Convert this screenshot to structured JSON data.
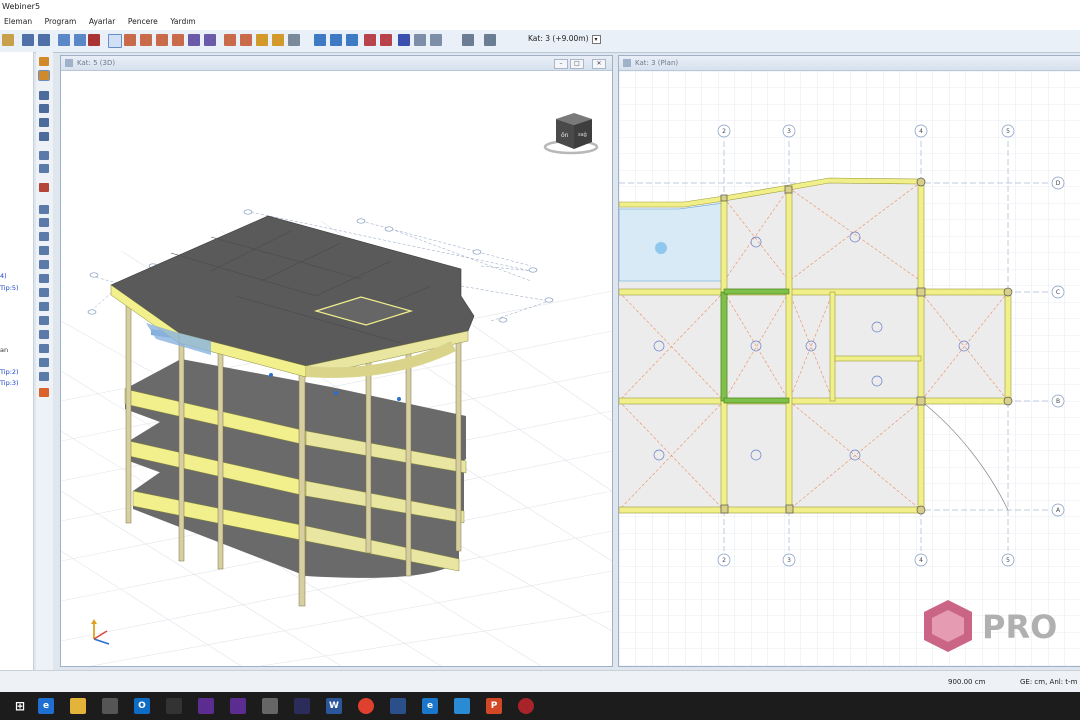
{
  "app": {
    "title": "Webiner5"
  },
  "menu": [
    "Eleman",
    "Program",
    "Ayarlar",
    "Pencere",
    "Yardım"
  ],
  "toolbar": {
    "floor_label": "Kat: 3 (+9.00m)"
  },
  "left_panel": {
    "labels": [
      "4)",
      "Tip:5)",
      "an",
      "Tip:2)",
      "Tip:3)"
    ]
  },
  "pane_3d": {
    "title": "Kat: 5 (3D)",
    "view_cube": {
      "face_front": "ön",
      "face_right": "sağ"
    }
  },
  "pane_plan": {
    "title": "Kat: 3 (Plan)",
    "grid_x": [
      "2",
      "3",
      "4",
      "5"
    ],
    "grid_y": [
      "D",
      "C",
      "B",
      "A"
    ]
  },
  "status": {
    "scale": "900.00 cm",
    "units": "GE: cm, Anl: t-m"
  },
  "watermark": {
    "text": "PRO"
  },
  "taskbar": {
    "icons": [
      "start",
      "edge",
      "explorer",
      "store",
      "outlook",
      "app",
      "visual-studio",
      "visual-studio",
      "calculator",
      "app",
      "word",
      "chrome",
      "app",
      "ie",
      "app",
      "powerpoint",
      "app"
    ]
  },
  "colors": {
    "slab": "#5a5a5a",
    "beam": "#f2f08c",
    "column": "#d8cfa0",
    "plan_beam": "#f0ef8a",
    "plan_grid": "#c9d4e4",
    "accent": "#2a6fd1"
  }
}
